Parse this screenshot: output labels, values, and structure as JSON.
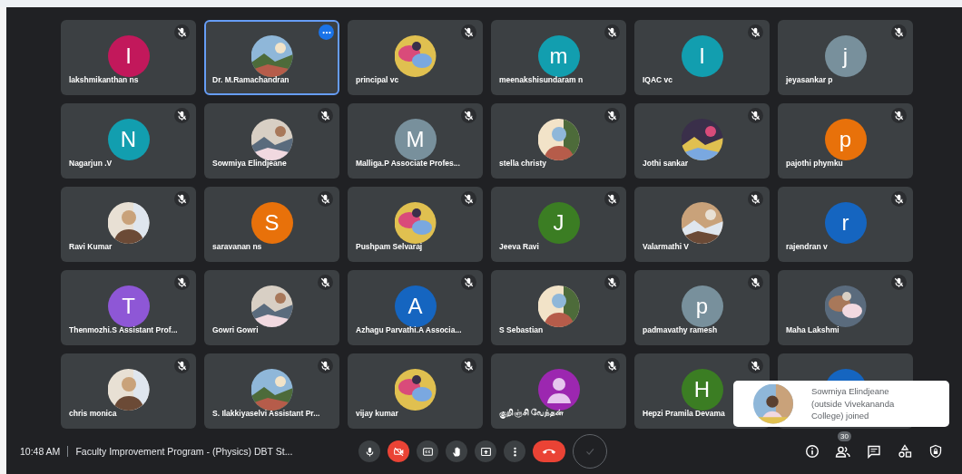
{
  "tiles": [
    {
      "kind": "letter",
      "letter": "I",
      "color": "#c2185b",
      "name": "lakshmikanthan ns",
      "muted": true,
      "selected": false
    },
    {
      "kind": "picture",
      "name": "Dr. M.Ramachandran",
      "muted": false,
      "selected": true
    },
    {
      "kind": "picture",
      "name": "principal vc",
      "muted": true,
      "selected": false
    },
    {
      "kind": "letter",
      "letter": "m",
      "color": "#129eaf",
      "name": "meenakshisundaram n",
      "muted": true,
      "selected": false
    },
    {
      "kind": "letter",
      "letter": "I",
      "color": "#129eaf",
      "name": "IQAC vc",
      "muted": true,
      "selected": false
    },
    {
      "kind": "letter",
      "letter": "j",
      "color": "#78909c",
      "name": "jeyasankar p",
      "muted": true,
      "selected": false
    },
    {
      "kind": "letter",
      "letter": "N",
      "color": "#129eaf",
      "name": "Nagarjun .V",
      "muted": true,
      "selected": false
    },
    {
      "kind": "picture",
      "name": "Sowmiya Elindjeane",
      "muted": true,
      "selected": false
    },
    {
      "kind": "letter",
      "letter": "M",
      "color": "#78909c",
      "name": "Malliga.P Associate Profes...",
      "muted": true,
      "selected": false
    },
    {
      "kind": "picture",
      "name": "stella christy",
      "muted": true,
      "selected": false
    },
    {
      "kind": "picture",
      "name": "Jothi sankar",
      "muted": true,
      "selected": false
    },
    {
      "kind": "letter",
      "letter": "p",
      "color": "#e8710a",
      "name": "pajothi phymku",
      "muted": true,
      "selected": false
    },
    {
      "kind": "picture",
      "name": "Ravi Kumar",
      "muted": true,
      "selected": false
    },
    {
      "kind": "letter",
      "letter": "S",
      "color": "#e8710a",
      "name": "saravanan ns",
      "muted": true,
      "selected": false
    },
    {
      "kind": "picture",
      "name": "Pushpam Selvaraj",
      "muted": true,
      "selected": false
    },
    {
      "kind": "letter",
      "letter": "J",
      "color": "#3b7d23",
      "name": "Jeeva Ravi",
      "muted": true,
      "selected": false
    },
    {
      "kind": "picture",
      "name": "Valarmathi V",
      "muted": true,
      "selected": false
    },
    {
      "kind": "letter",
      "letter": "r",
      "color": "#1565c0",
      "name": "rajendran v",
      "muted": true,
      "selected": false
    },
    {
      "kind": "letter",
      "letter": "T",
      "color": "#8e57d6",
      "name": "Thenmozhi.S Assistant Prof...",
      "muted": true,
      "selected": false
    },
    {
      "kind": "picture",
      "name": "Gowri Gowri",
      "muted": true,
      "selected": false
    },
    {
      "kind": "letter",
      "letter": "A",
      "color": "#1565c0",
      "name": "Azhagu Parvathi.A Associa...",
      "muted": true,
      "selected": false
    },
    {
      "kind": "picture",
      "name": "S Sebastian",
      "muted": true,
      "selected": false
    },
    {
      "kind": "letter",
      "letter": "p",
      "color": "#78909c",
      "name": "padmavathy ramesh",
      "muted": true,
      "selected": false
    },
    {
      "kind": "picture",
      "name": "Maha Lakshmi",
      "muted": true,
      "selected": false
    },
    {
      "kind": "picture",
      "name": "chris monica",
      "muted": true,
      "selected": false
    },
    {
      "kind": "picture",
      "name": "S. Ilakkiyaselvi Assistant Pr...",
      "muted": true,
      "selected": false
    },
    {
      "kind": "picture",
      "name": "vijay kumar",
      "muted": true,
      "selected": false
    },
    {
      "kind": "person",
      "color": "#9c27b0",
      "name": "குறிஞ்சி வேந்தன்",
      "muted": true,
      "selected": false
    },
    {
      "kind": "letter",
      "letter": "H",
      "color": "#3b7d23",
      "name": "Hepzi Pramila Devama",
      "muted": true,
      "selected": false
    },
    {
      "kind": "letter",
      "color": "#1565c0",
      "selected": false
    }
  ],
  "toast": {
    "message": "Sowmiya Elindjeane (outside Vivekananda College) joined"
  },
  "bottom_bar": {
    "time": "10:48 AM",
    "meeting_title": "Faculty Improvement Program - (Physics) DBT St...",
    "controls": [
      {
        "kind": "mic",
        "off": false
      },
      {
        "kind": "camera",
        "off": true
      },
      {
        "kind": "captions"
      },
      {
        "kind": "hand"
      },
      {
        "kind": "present"
      },
      {
        "kind": "more"
      },
      {
        "kind": "end-call"
      },
      {
        "kind": "check"
      }
    ],
    "side_buttons": [
      {
        "kind": "info"
      },
      {
        "kind": "people",
        "badge": "30"
      },
      {
        "kind": "chat"
      },
      {
        "kind": "activities"
      },
      {
        "kind": "lock"
      }
    ]
  }
}
